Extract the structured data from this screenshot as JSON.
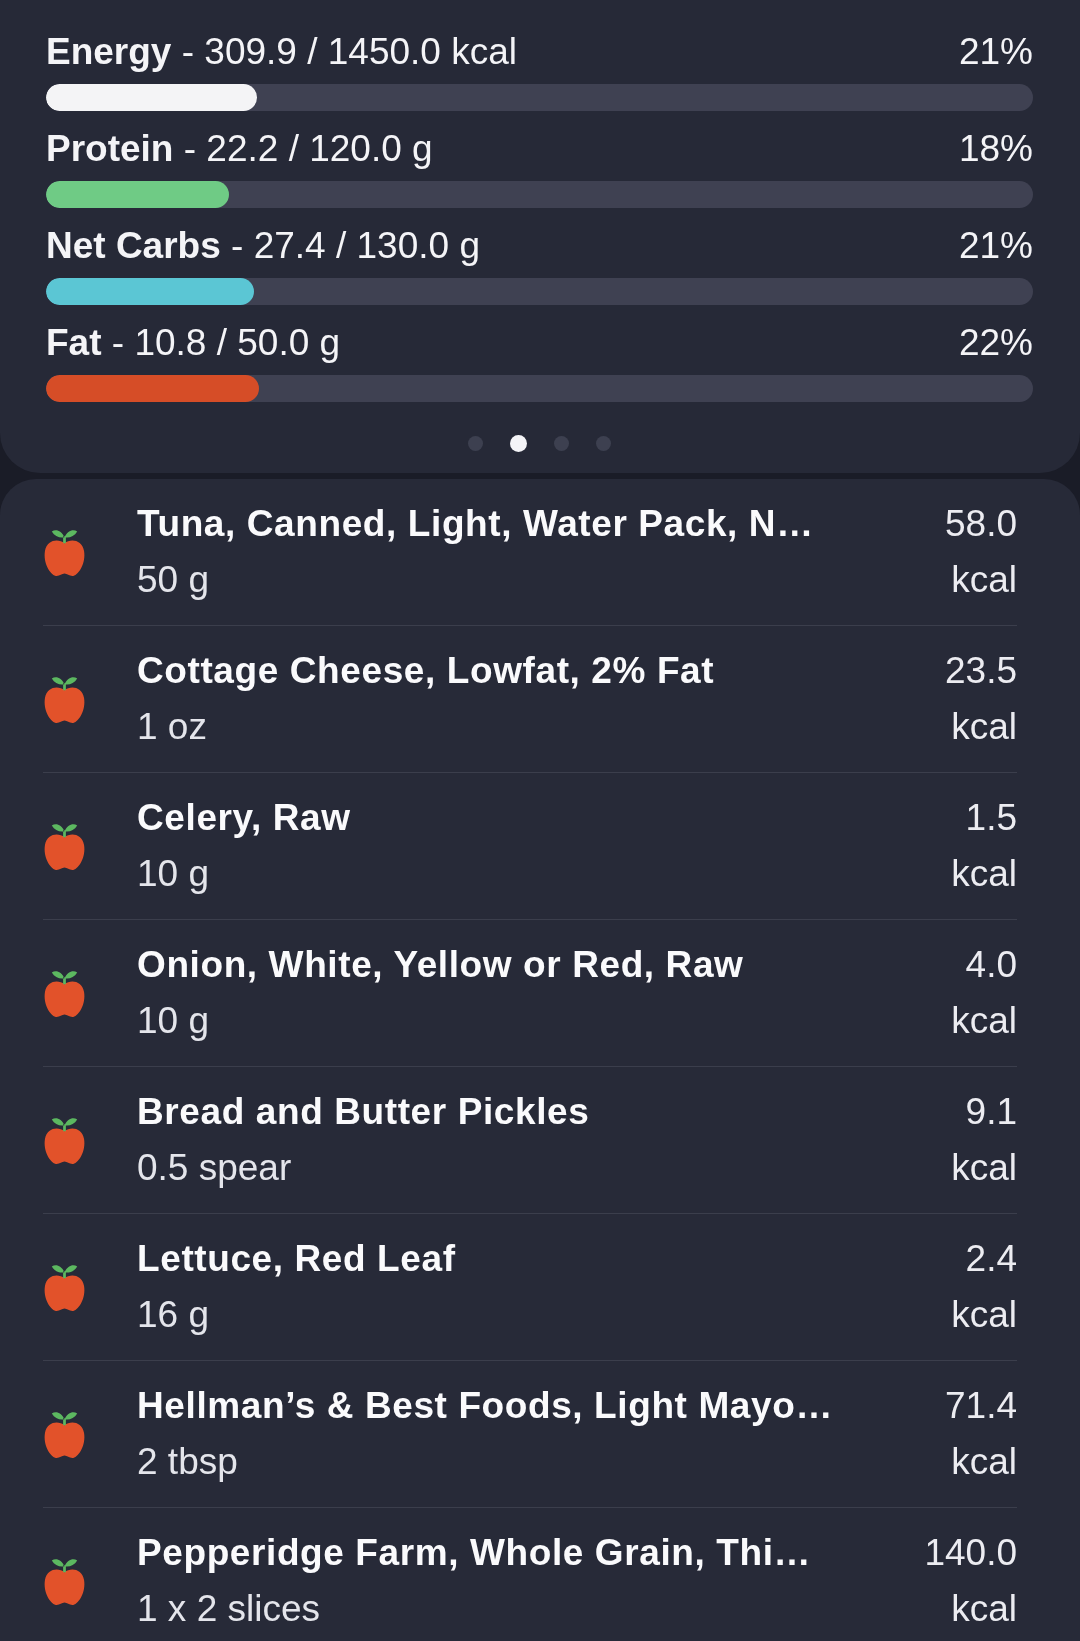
{
  "nutrients": [
    {
      "label": "**Energy** - 309.9 / 1450.0 kcal",
      "percent": "21%",
      "level": 0.214,
      "color": "#f4f4f6"
    },
    {
      "label": "**Protein** - 22.2 / 120.0 g",
      "percent": "18%",
      "level": 0.185,
      "color": "#6fcb85"
    },
    {
      "label": "**Net Carbs** - 27.4 / 130.0 g",
      "percent": "21%",
      "level": 0.211,
      "color": "#5bc6d4"
    },
    {
      "label": "**Fat** - 10.8 / 50.0 g",
      "percent": "22%",
      "level": 0.216,
      "color": "#d64d27"
    }
  ],
  "pager": {
    "dots": [
      {
        "selected": false
      },
      {
        "selected": true
      },
      {
        "selected": false
      },
      {
        "selected": false
      }
    ]
  },
  "foods": [
    {
      "name": "Tuna, Canned, Light, Water Pack, N…",
      "serving": "50 g",
      "calories": "58.0",
      "unit": "kcal"
    },
    {
      "name": "Cottage Cheese, Lowfat, 2% Fat",
      "serving": "1 oz",
      "calories": "23.5",
      "unit": "kcal"
    },
    {
      "name": "Celery, Raw",
      "serving": "10 g",
      "calories": "1.5",
      "unit": "kcal"
    },
    {
      "name": "Onion, White, Yellow or Red, Raw",
      "serving": "10 g",
      "calories": "4.0",
      "unit": "kcal"
    },
    {
      "name": "Bread and Butter Pickles",
      "serving": "0.5 spear",
      "calories": "9.1",
      "unit": "kcal"
    },
    {
      "name": "Lettuce, Red Leaf",
      "serving": "16 g",
      "calories": "2.4",
      "unit": "kcal"
    },
    {
      "name": "Hellman’s & Best Foods, Light Mayo…",
      "serving": "2 tbsp",
      "calories": "71.4",
      "unit": "kcal"
    },
    {
      "name": "Pepperidge Farm, Whole Grain, Thi…",
      "serving": "1 x 2 slices",
      "calories": "140.0",
      "unit": "kcal"
    }
  ]
}
